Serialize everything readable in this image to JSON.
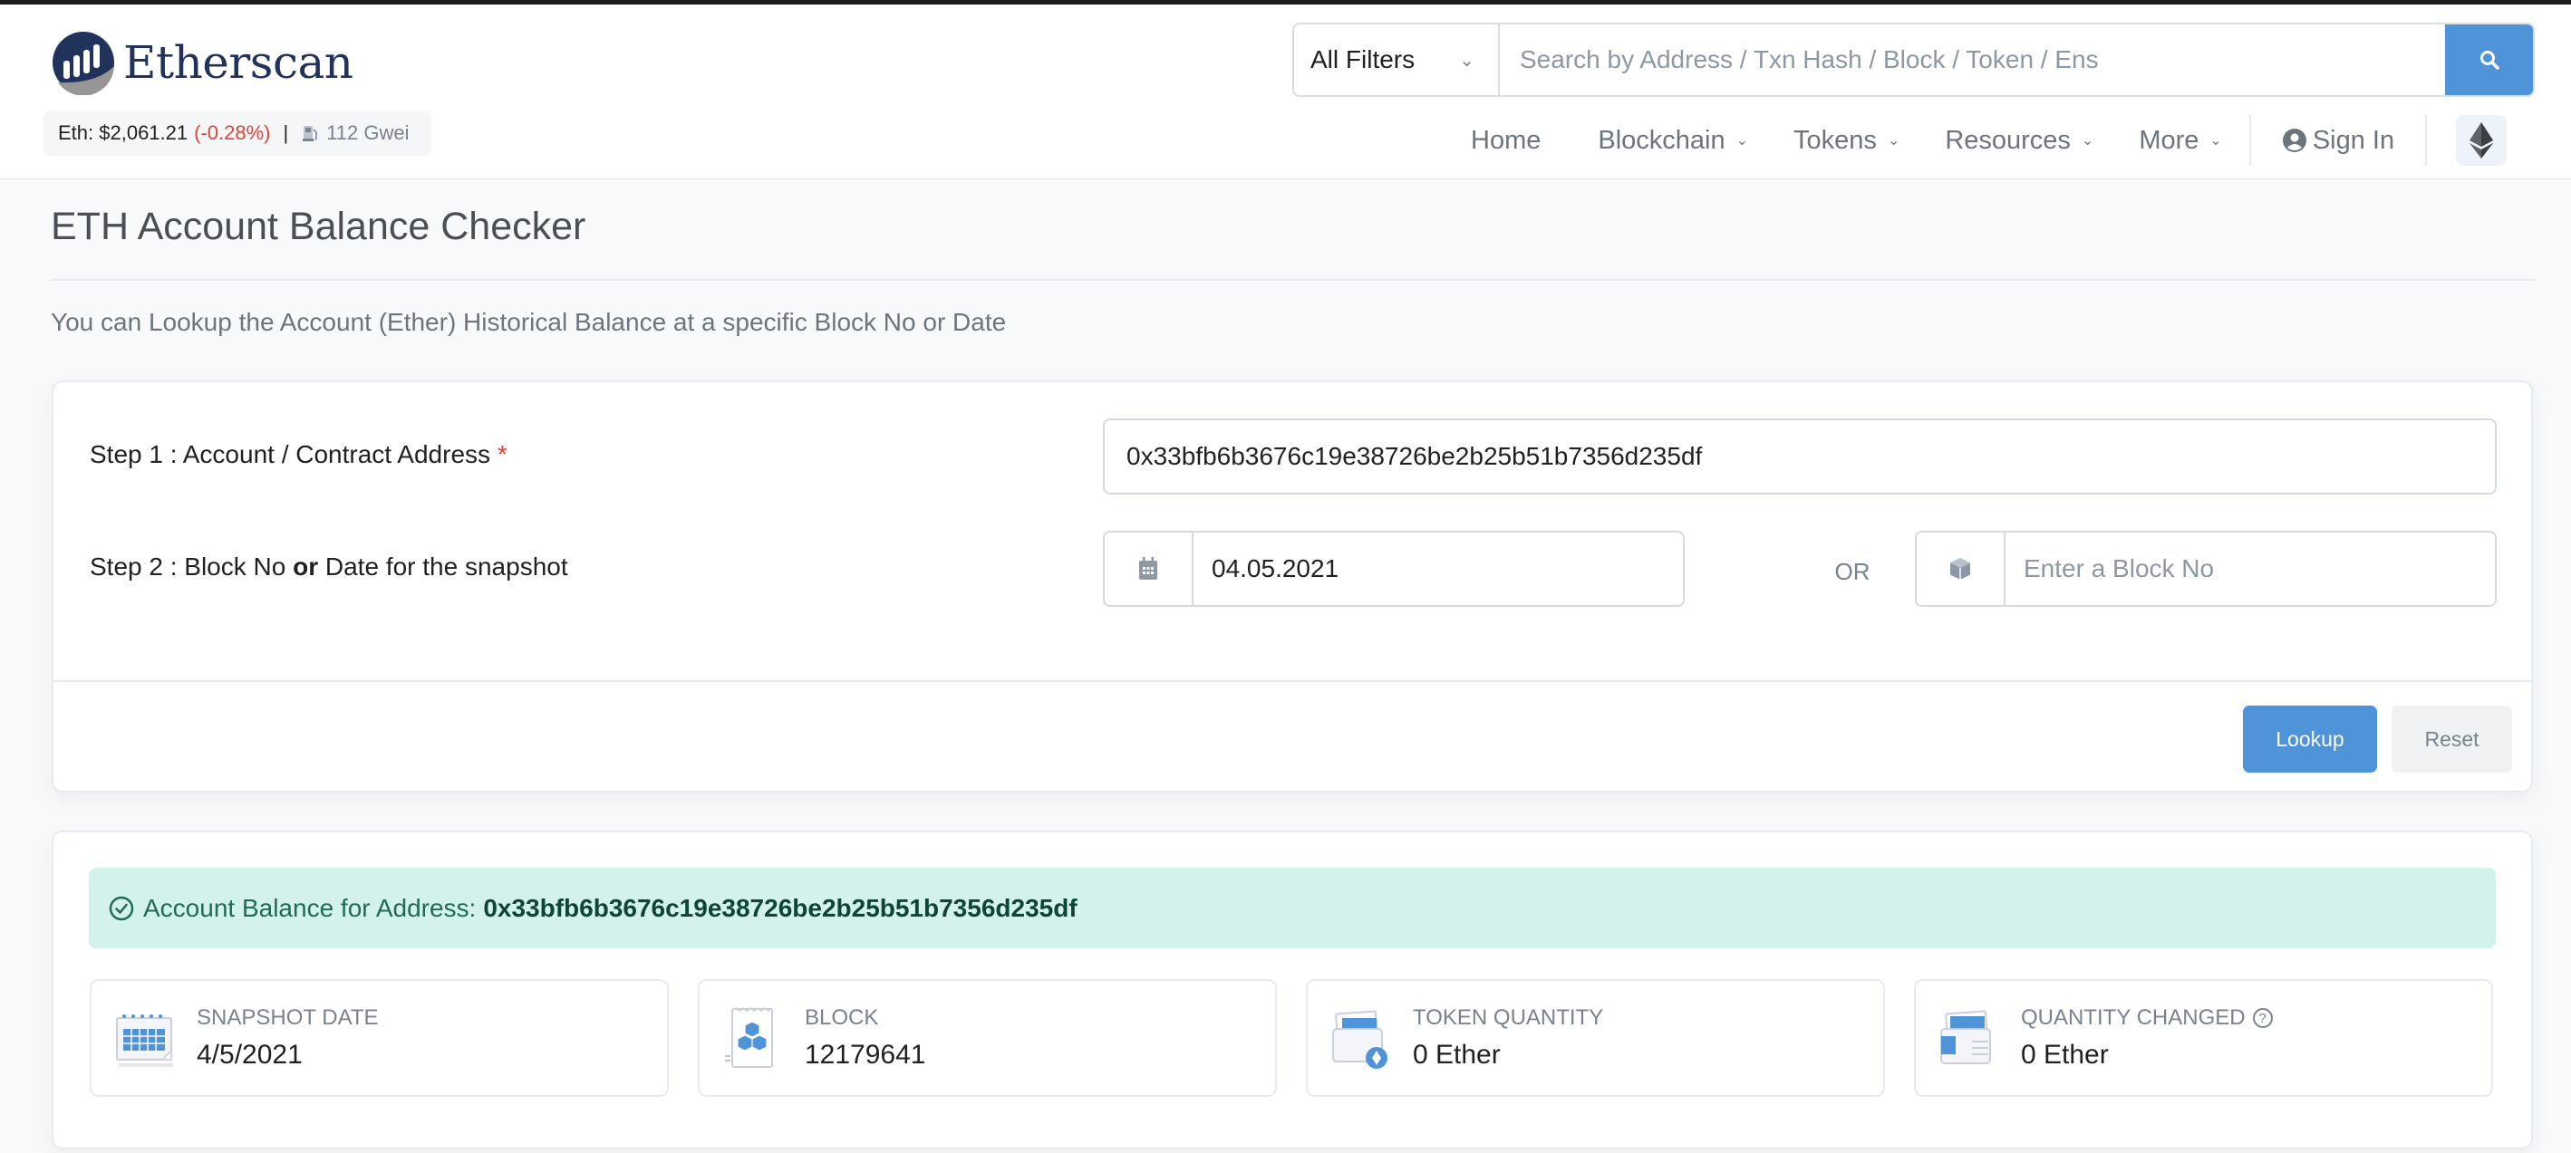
{
  "header": {
    "logo_text": "Etherscan",
    "price": {
      "label": "Eth: $2,061.21",
      "change": "(-0.28%)",
      "separator": "|",
      "gas": "112 Gwei",
      "change_color": "#de4437"
    },
    "search": {
      "filter_selected": "All Filters",
      "placeholder": "Search by Address / Txn Hash / Block / Token / Ens",
      "value": "",
      "button_icon": "search-icon"
    },
    "nav": [
      {
        "label": "Home",
        "dropdown": false
      },
      {
        "label": "Blockchain",
        "dropdown": true
      },
      {
        "label": "Tokens",
        "dropdown": true
      },
      {
        "label": "Resources",
        "dropdown": true
      },
      {
        "label": "More",
        "dropdown": true
      }
    ],
    "sign_in": "Sign In",
    "network_icon": "ethereum-icon"
  },
  "page": {
    "title": "ETH Account Balance Checker",
    "description": "You can Lookup the Account (Ether) Historical Balance at a specific Block No or Date"
  },
  "form": {
    "step1": {
      "label": "Step 1 : Account / Contract Address",
      "required_mark": "*",
      "value": "0x33bfb6b3676c19e38726be2b25b51b7356d235df"
    },
    "step2": {
      "label_pre": "Step 2 : Block No ",
      "label_bold": "or",
      "label_post": " Date for the snapshot",
      "date_value": "04.05.2021",
      "or_label": "OR",
      "block_placeholder": "Enter a Block No",
      "block_value": ""
    },
    "buttons": {
      "lookup": "Lookup",
      "reset": "Reset"
    }
  },
  "result": {
    "alert_prefix": "Account Balance for Address:",
    "alert_address": "0x33bfb6b3676c19e38726be2b25b51b7356d235df",
    "stats": [
      {
        "label": "Snapshot Date",
        "value": "4/5/2021",
        "icon": "calendar-icon"
      },
      {
        "label": "Block",
        "value": "12179641",
        "icon": "block-icon"
      },
      {
        "label": "Token Quantity",
        "value": "0 Ether",
        "icon": "wallet-ether-icon"
      },
      {
        "label": "Quantity Changed",
        "value": "0 Ether",
        "icon": "wallet-change-icon",
        "help": "?"
      }
    ]
  },
  "colors": {
    "primary": "#4f93d9",
    "brand_navy": "#21325b",
    "success_bg": "#d4f2ec",
    "danger": "#de4437"
  }
}
